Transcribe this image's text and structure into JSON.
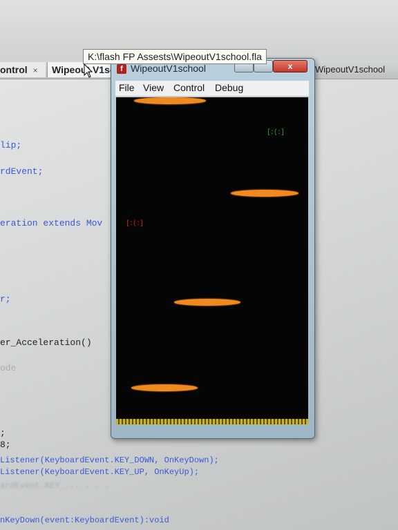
{
  "editor": {
    "tabs": [
      {
        "label": "ontrol",
        "close": "×"
      },
      {
        "label": "Wipeout V1sc"
      },
      {
        "label": "WipeoutV1school"
      }
    ],
    "code_lines": [
      {
        "text": "lip;"
      },
      {
        "text": "rdEvent;"
      },
      {
        "text": "eration extends Mov"
      },
      {
        "text": "r;"
      },
      {
        "text": "er_Acceleration()"
      },
      {
        "text": "ode"
      },
      {
        "text": ";"
      },
      {
        "text": "8;"
      },
      {
        "text": "Listener(KeyboardEvent.KEY_DOWN, OnKeyDown);"
      },
      {
        "text": "Listener(KeyboardEvent.KEY_UP, OnKeyUp);"
      },
      {
        "text": "nKeyDown(event:KeyboardEvent):void"
      }
    ]
  },
  "tooltip": {
    "text": "K:\\flash FP Assests\\WipeoutV1school.fla"
  },
  "player": {
    "title": "WipeoutV1school",
    "icon": "flash-icon",
    "close_symbol": "x",
    "menu": [
      "File",
      "View",
      "Control",
      "Debug"
    ],
    "sprites": {
      "green": "[:(:]",
      "red": "[:(:]"
    }
  },
  "colors": {
    "stage_bg": "#050505",
    "paddle": "#f08a1e",
    "floor": "#c9b21a",
    "green_sprite": "#2fa32f",
    "red_sprite": "#e01a1a",
    "code_keyword": "#3a58d8"
  }
}
